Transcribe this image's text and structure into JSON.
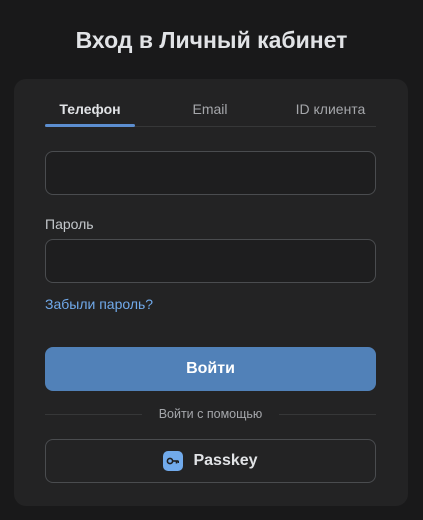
{
  "header": {
    "title": "Вход в Личный кабинет"
  },
  "tabs": [
    {
      "label": "Телефон",
      "active": true
    },
    {
      "label": "Email",
      "active": false
    },
    {
      "label": "ID клиента",
      "active": false
    }
  ],
  "form": {
    "phone_value": "",
    "password_label": "Пароль",
    "password_value": "",
    "forgot_link": "Забыли пароль?",
    "submit_label": "Войти",
    "divider_text": "Войти с помощью",
    "passkey_label": "Passkey"
  },
  "colors": {
    "background": "#19191a",
    "card": "#232324",
    "accent": "#5181b8",
    "link": "#71aaeb",
    "tab_underline": "#5c8ed0"
  },
  "icons": {
    "passkey": "key-icon"
  }
}
